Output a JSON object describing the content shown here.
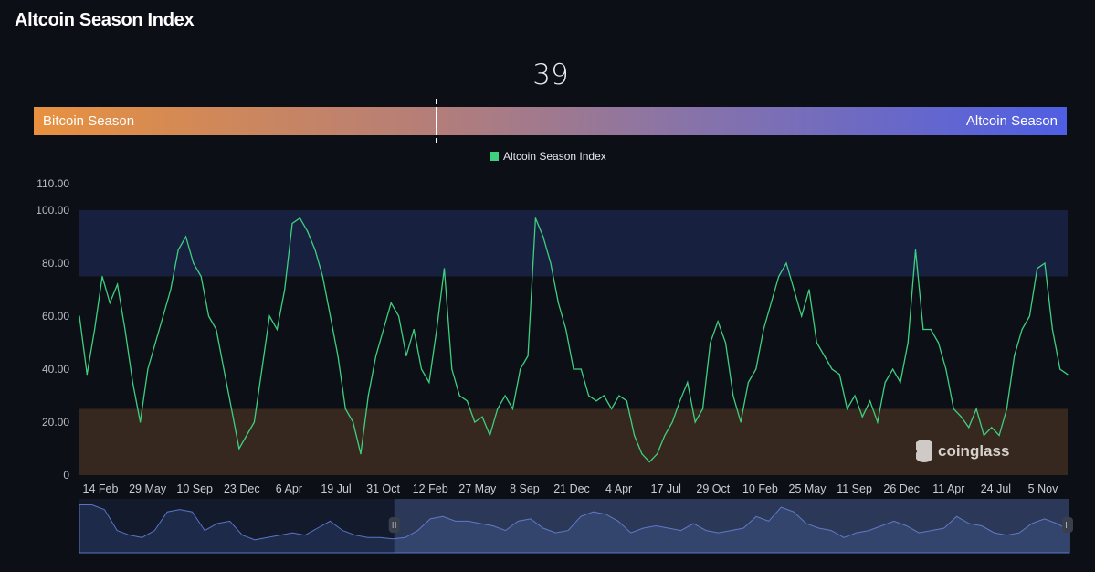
{
  "title": "Altcoin Season Index",
  "gauge": {
    "value": "39",
    "value_num": 39,
    "left_label": "Bitcoin Season",
    "right_label": "Altcoin Season",
    "colors": {
      "left": "#e8913f",
      "right": "#4f5fe3"
    }
  },
  "watermark": "coinglass",
  "chart_data": {
    "type": "line",
    "legend": [
      {
        "name": "Altcoin Season Index",
        "color": "#3ecf7f"
      }
    ],
    "legend_placement": "top-center",
    "ylim": [
      0,
      110
    ],
    "y_ticks": [
      "0",
      "20.00",
      "40.00",
      "60.00",
      "80.00",
      "100.00",
      "110.00"
    ],
    "x_ticks": [
      "14 Feb",
      "29 May",
      "10 Sep",
      "23 Dec",
      "6 Apr",
      "19 Jul",
      "31 Oct",
      "12 Feb",
      "27 May",
      "8 Sep",
      "21 Dec",
      "4 Apr",
      "17 Jul",
      "29 Oct",
      "10 Feb",
      "25 May",
      "11 Sep",
      "26 Dec",
      "11 Apr",
      "24 Jul",
      "5 Nov"
    ],
    "bands": [
      {
        "from": 75,
        "to": 100,
        "color": "#17213f"
      },
      {
        "from": 0,
        "to": 25,
        "color": "#36281e"
      }
    ],
    "grid": false,
    "series": [
      {
        "name": "Altcoin Season Index",
        "color": "#3ecf7f",
        "values": [
          60,
          38,
          55,
          75,
          65,
          72,
          55,
          35,
          20,
          40,
          50,
          60,
          70,
          85,
          90,
          80,
          75,
          60,
          55,
          40,
          25,
          10,
          15,
          20,
          40,
          60,
          55,
          70,
          95,
          97,
          92,
          85,
          75,
          60,
          45,
          25,
          20,
          8,
          30,
          45,
          55,
          65,
          60,
          45,
          55,
          40,
          35,
          55,
          78,
          40,
          30,
          28,
          20,
          22,
          15,
          25,
          30,
          25,
          40,
          45,
          97,
          90,
          80,
          65,
          55,
          40,
          40,
          30,
          28,
          30,
          25,
          30,
          28,
          15,
          8,
          5,
          8,
          15,
          20,
          28,
          35,
          20,
          25,
          50,
          58,
          50,
          30,
          20,
          35,
          40,
          55,
          65,
          75,
          80,
          70,
          60,
          70,
          50,
          45,
          40,
          38,
          25,
          30,
          22,
          28,
          20,
          35,
          40,
          35,
          50,
          85,
          55,
          55,
          50,
          40,
          25,
          22,
          18,
          25,
          15,
          18,
          15,
          25,
          45,
          55,
          60,
          78,
          80,
          55,
          40,
          38
        ]
      }
    ],
    "navigator": {
      "selected_range_fraction": [
        0.318,
        1.0
      ],
      "values": [
        95,
        95,
        85,
        40,
        30,
        25,
        40,
        80,
        85,
        80,
        40,
        55,
        60,
        30,
        20,
        25,
        30,
        35,
        30,
        45,
        60,
        40,
        30,
        25,
        25,
        22,
        25,
        40,
        65,
        70,
        60,
        60,
        55,
        50,
        40,
        60,
        65,
        45,
        35,
        40,
        70,
        80,
        75,
        60,
        35,
        45,
        50,
        45,
        40,
        55,
        40,
        35,
        40,
        45,
        70,
        60,
        90,
        80,
        55,
        45,
        40,
        25,
        35,
        40,
        50,
        60,
        50,
        35,
        40,
        45,
        70,
        55,
        50,
        35,
        30,
        35,
        55,
        65,
        55,
        40
      ]
    }
  }
}
